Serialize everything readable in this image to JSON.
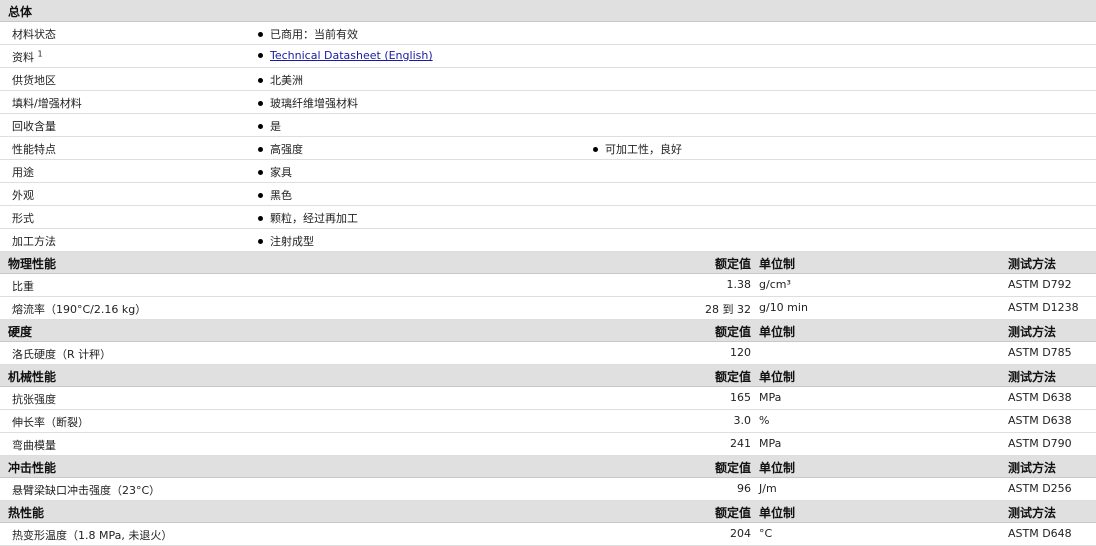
{
  "general": {
    "title": "总体",
    "rows": [
      {
        "label": "材料状态",
        "items": [
          "已商用：当前有效"
        ]
      },
      {
        "label": "资料",
        "sup": "1",
        "link": "Technical Datasheet (English)"
      },
      {
        "label": "供货地区",
        "items": [
          "北美洲"
        ]
      },
      {
        "label": "填料/增强材料",
        "items": [
          "玻璃纤维增强材料"
        ]
      },
      {
        "label": "回收含量",
        "items": [
          "是"
        ]
      },
      {
        "label": "性能特点",
        "items": [
          "高强度",
          "可加工性，良好"
        ]
      },
      {
        "label": "用途",
        "items": [
          "家具"
        ]
      },
      {
        "label": "外观",
        "items": [
          "黑色"
        ]
      },
      {
        "label": "形式",
        "items": [
          "颗粒，经过再加工"
        ]
      },
      {
        "label": "加工方法",
        "items": [
          "注射成型"
        ]
      }
    ]
  },
  "col_headers": {
    "value": "额定值",
    "unit": "单位制",
    "method": "测试方法"
  },
  "sections": [
    {
      "title": "物理性能",
      "rows": [
        {
          "label": "比重",
          "value": "1.38",
          "unit": "g/cm³",
          "method": "ASTM D792"
        },
        {
          "label": "熔流率（190°C/2.16 kg）",
          "value": "28 到 32",
          "unit": "g/10 min",
          "method": "ASTM D1238"
        }
      ]
    },
    {
      "title": "硬度",
      "rows": [
        {
          "label": "洛氏硬度（R 计秤）",
          "value": "120",
          "unit": "",
          "method": "ASTM D785"
        }
      ]
    },
    {
      "title": "机械性能",
      "rows": [
        {
          "label": "抗张强度",
          "value": "165",
          "unit": "MPa",
          "method": "ASTM D638"
        },
        {
          "label": "伸长率（断裂）",
          "value": "3.0",
          "unit": "%",
          "method": "ASTM D638"
        },
        {
          "label": "弯曲模量",
          "value": "241",
          "unit": "MPa",
          "method": "ASTM D790"
        }
      ]
    },
    {
      "title": "冲击性能",
      "rows": [
        {
          "label": "悬臂梁缺口冲击强度（23°C）",
          "value": "96",
          "unit": "J/m",
          "method": "ASTM D256"
        }
      ]
    },
    {
      "title": "热性能",
      "rows": [
        {
          "label": "热变形温度（1.8 MPa, 未退火）",
          "value": "204",
          "unit": "°C",
          "method": "ASTM D648"
        }
      ]
    }
  ]
}
